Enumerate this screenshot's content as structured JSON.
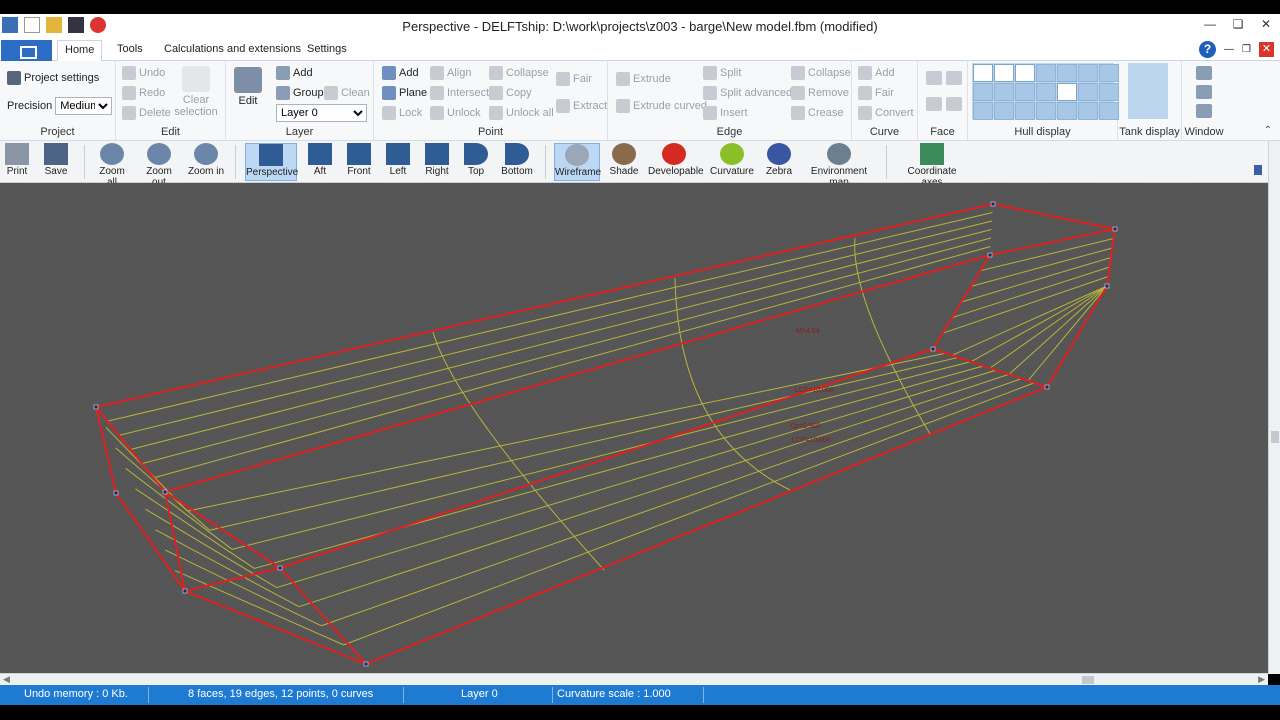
{
  "window": {
    "title": "Perspective - DELFTship: D:\\work\\projects\\z003 - barge\\New model.fbm (modified)"
  },
  "tabs": [
    "Home",
    "Tools",
    "Calculations and extensions",
    "Settings"
  ],
  "ribbon": {
    "project": {
      "label": "Project",
      "settings": "Project settings",
      "precision_label": "Precision",
      "precision_value": "Medium"
    },
    "edit": {
      "label": "Edit",
      "undo": "Undo",
      "redo": "Redo",
      "delete": "Delete",
      "clear1": "Clear",
      "clear2": "selection"
    },
    "layer": {
      "label": "Layer",
      "edit": "Edit",
      "add": "Add",
      "group": "Group",
      "clean": "Clean",
      "layer_value": "Layer 0"
    },
    "point": {
      "label": "Point",
      "add": "Add",
      "plane": "Plane",
      "lock": "Lock",
      "align": "Align",
      "intersect": "Intersect",
      "unlock": "Unlock",
      "collapse": "Collapse",
      "copy": "Copy",
      "unlock_all": "Unlock all",
      "fair": "Fair",
      "extract": "Extract"
    },
    "edge": {
      "label": "Edge",
      "extrude": "Extrude",
      "extrude_curved": "Extrude curved",
      "split": "Split",
      "split_advanced": "Split advanced",
      "insert": "Insert",
      "collapse": "Collapse",
      "remove": "Remove",
      "crease": "Crease"
    },
    "curve": {
      "label": "Curve",
      "add": "Add",
      "fair": "Fair",
      "convert": "Convert"
    },
    "face": {
      "label": "Face"
    },
    "hull_display": {
      "label": "Hull display"
    },
    "tank_display": {
      "label": "Tank display"
    },
    "window": {
      "label": "Window"
    }
  },
  "toolbar": {
    "print": "Print",
    "save": "Save",
    "zoom_all": "Zoom all",
    "zoom_out": "Zoom out",
    "zoom_in": "Zoom in",
    "perspective": "Perspective",
    "aft": "Aft",
    "front": "Front",
    "left": "Left",
    "right": "Right",
    "top": "Top",
    "bottom": "Bottom",
    "wireframe": "Wireframe",
    "shade": "Shade",
    "developable": "Developable",
    "curvature": "Curvature",
    "zebra": "Zebra",
    "environment_map": "Environment map",
    "coordinate_axes": "Coordinate axes"
  },
  "viewport": {
    "labels": [
      "LCF=10.000",
      "Cp=0.900",
      "M=4.04"
    ]
  },
  "status": {
    "undo_memory": "Undo memory : 0 Kb.",
    "counts": "8 faces, 19 edges, 12 points, 0 curves",
    "layer": "Layer 0",
    "curvature": "Curvature scale : 1.000"
  },
  "colors": {
    "edge_red": "#e02020",
    "grid_yellow": "#b9b43a",
    "status_blue": "#1f7bd1",
    "file_blue": "#2b6cc4"
  }
}
